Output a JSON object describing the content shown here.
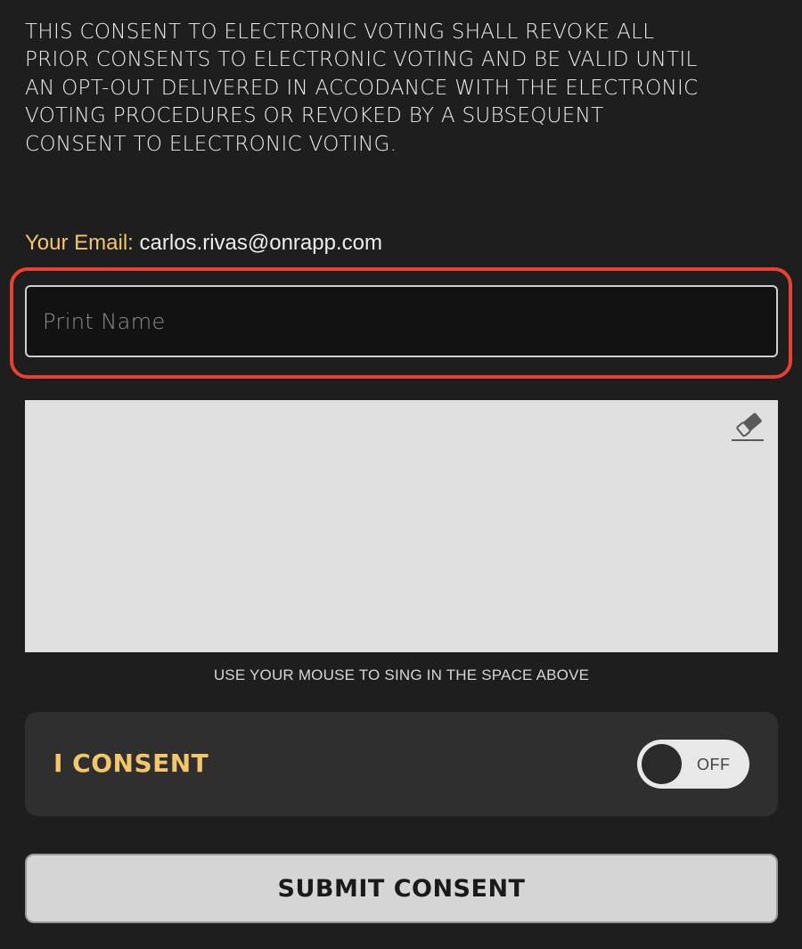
{
  "disclaimer": {
    "text": "THIS CONSENT TO ELECTRONIC VOTING SHALL REVOKE ALL\nPRIOR CONSENTS TO ELECTRONIC VOTING AND BE VALID UNTIL\nAN OPT-OUT DELIVERED IN ACCODANCE WITH THE ELECTRONIC\nVOTING PROCEDURES OR REVOKED BY A SUBSEQUENT\nCONSENT TO ELECTRONIC VOTING."
  },
  "email": {
    "label": "Your Email:",
    "value": "carlos.rivas@onrapp.com"
  },
  "print_name": {
    "placeholder": "Print Name",
    "value": ""
  },
  "signature": {
    "clear_icon": "eraser-icon",
    "hint": "USE YOUR MOUSE TO SING IN THE SPACE ABOVE"
  },
  "consent": {
    "label": "I CONSENT",
    "toggle_state": "OFF"
  },
  "submit": {
    "label": "SUBMIT CONSENT"
  },
  "colors": {
    "background": "#1e1e1e",
    "accent": "#f3c66b",
    "highlight": "#e9412f",
    "card": "#2f2f2f",
    "signature_pad": "#e0e0e0"
  }
}
